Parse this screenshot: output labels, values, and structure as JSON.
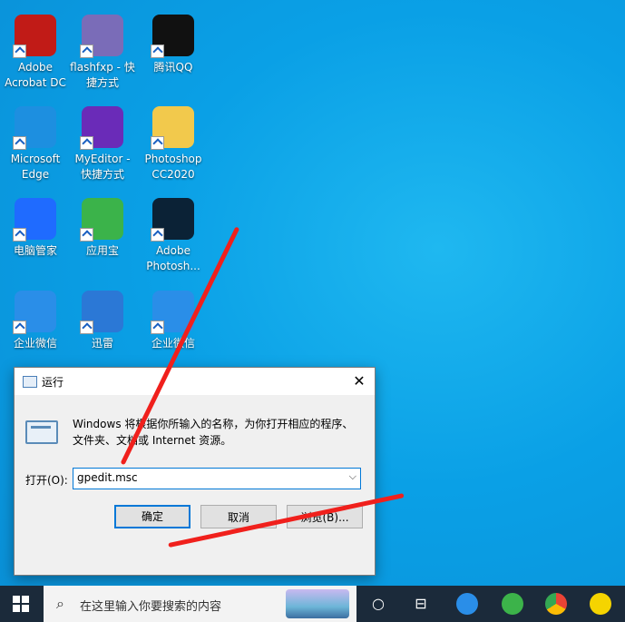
{
  "desktop_icons": [
    {
      "name": "adobe-acrobat-icon",
      "label": "Adobe\nAcrobat DC",
      "color": "#c11b17"
    },
    {
      "name": "flashfxp-icon",
      "label": "flashfxp - 快\n捷方式",
      "color": "#7a6cb8"
    },
    {
      "name": "qq-icon",
      "label": "腾讯QQ",
      "color": "#111111"
    },
    {
      "name": "edge-icon",
      "label": "Microsoft\nEdge",
      "color": "#1d8fe0"
    },
    {
      "name": "myeditor-icon",
      "label": "MyEditor -\n快捷方式",
      "color": "#6a2bb8"
    },
    {
      "name": "photoshop-folder-icon",
      "label": "Photoshop\nCC2020",
      "color": "#f2c94c"
    },
    {
      "name": "pc-manager-icon",
      "label": "电脑管家",
      "color": "#1f6bff"
    },
    {
      "name": "yingyongbao-icon",
      "label": "应用宝",
      "color": "#3bb34a"
    },
    {
      "name": "photoshop-icon",
      "label": "Adobe\nPhotosh...",
      "color": "#0b2236"
    },
    {
      "name": "wecom-icon",
      "label": "企业微信",
      "color": "#2a8ee8"
    },
    {
      "name": "xunlei-icon",
      "label": "迅雷",
      "color": "#2b78d6"
    },
    {
      "name": "wecom2-icon",
      "label": "企业微信",
      "color": "#2a8ee8"
    }
  ],
  "dialog": {
    "title": "运行",
    "close": "✕",
    "description": "Windows 将根据你所输入的名称，为你打开相应的程序、文件夹、文档或 Internet 资源。",
    "open_label": "打开(O):",
    "open_value": "gpedit.msc",
    "ok": "确定",
    "cancel": "取消",
    "browse": "浏览(B)..."
  },
  "taskbar": {
    "search_placeholder": "在这里输入你要搜索的内容"
  }
}
